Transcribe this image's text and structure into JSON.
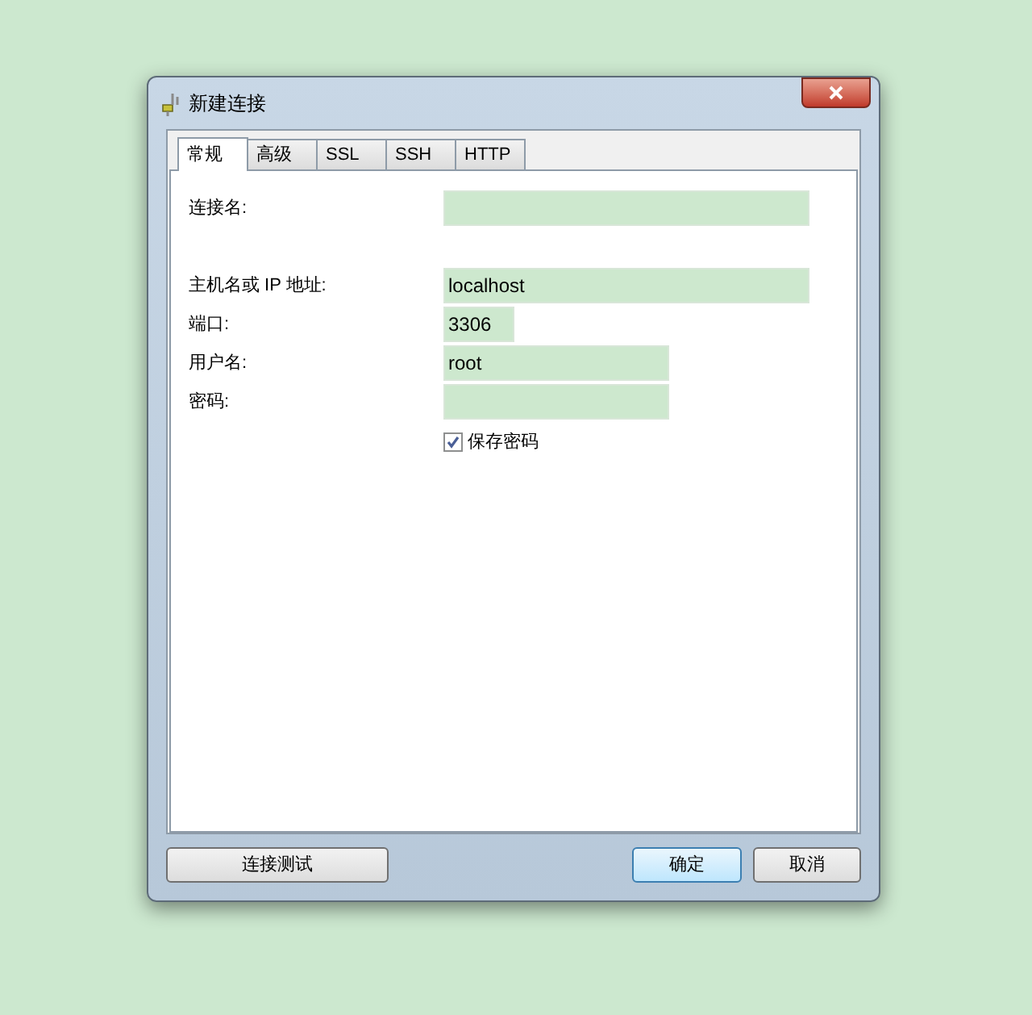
{
  "window": {
    "title": "新建连接"
  },
  "tabs": [
    {
      "label": "常规",
      "selected": true
    },
    {
      "label": "高级",
      "selected": false
    },
    {
      "label": "SSL",
      "selected": false
    },
    {
      "label": "SSH",
      "selected": false
    },
    {
      "label": "HTTP",
      "selected": false
    }
  ],
  "fields": [
    {
      "label": "连接名:"
    },
    {
      "label": "主机名或 IP 地址:",
      "value": "localhost"
    },
    {
      "label": "端口:",
      "value": "3306"
    },
    {
      "label": "用户名:",
      "value": "root"
    },
    {
      "label": "密码:"
    }
  ],
  "save_password": {
    "label": "保存密码",
    "checked": true
  },
  "buttons": [
    {
      "label": "连接测试",
      "default": false
    },
    {
      "label": "确定",
      "default": true
    },
    {
      "label": "取消",
      "default": false
    }
  ]
}
